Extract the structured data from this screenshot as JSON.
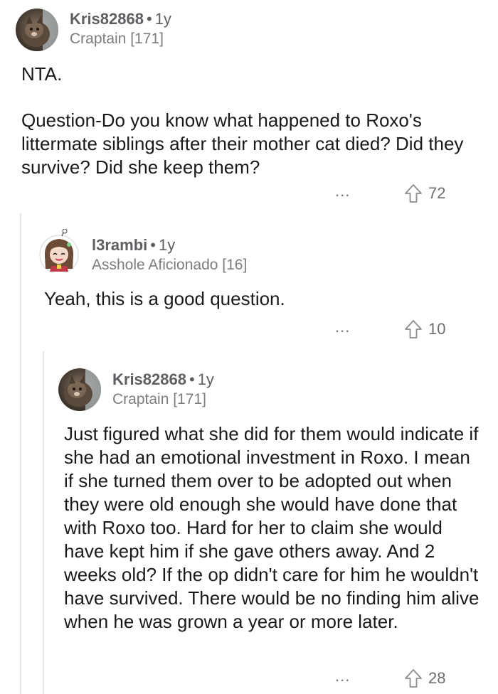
{
  "comments": [
    {
      "username": "Kris82868",
      "age": "1y",
      "flair": "Craptain [171]",
      "body": [
        "NTA.",
        "Question-Do you know  what happened to Roxo's littermate siblings after their mother cat died? Did they survive? Did she keep them?"
      ],
      "more": "...",
      "votes": "72"
    },
    {
      "username": "l3rambi",
      "age": "1y",
      "flair": "Asshole Aficionado [16]",
      "body": [
        "Yeah, this is a good question."
      ],
      "more": "...",
      "votes": "10"
    },
    {
      "username": "Kris82868",
      "age": "1y",
      "flair": "Craptain [171]",
      "body": [
        "Just figured what she did for them would indicate if she had an emotional investment in Roxo. I mean if she turned them over to be adopted out when they were old enough she would have done that with Roxo too. Hard for her to claim she would have kept him if she gave others away. And 2 weeks old? If the op didn't care for him he wouldn't have survived. There would be no finding him alive when he was grown a year or more later."
      ],
      "more": "...",
      "votes": "28"
    }
  ],
  "separator": "•",
  "icons": {
    "avatar_1": "cat-photo-avatar",
    "avatar_2": "anime-character-avatar",
    "avatar_3": "cat-photo-avatar",
    "upvote": "upvote-arrow-icon",
    "more": "more-options-icon"
  },
  "colors": {
    "text": "#1a1a1b",
    "meta": "#5d5f62",
    "thread_line": "#e3e4e6"
  }
}
